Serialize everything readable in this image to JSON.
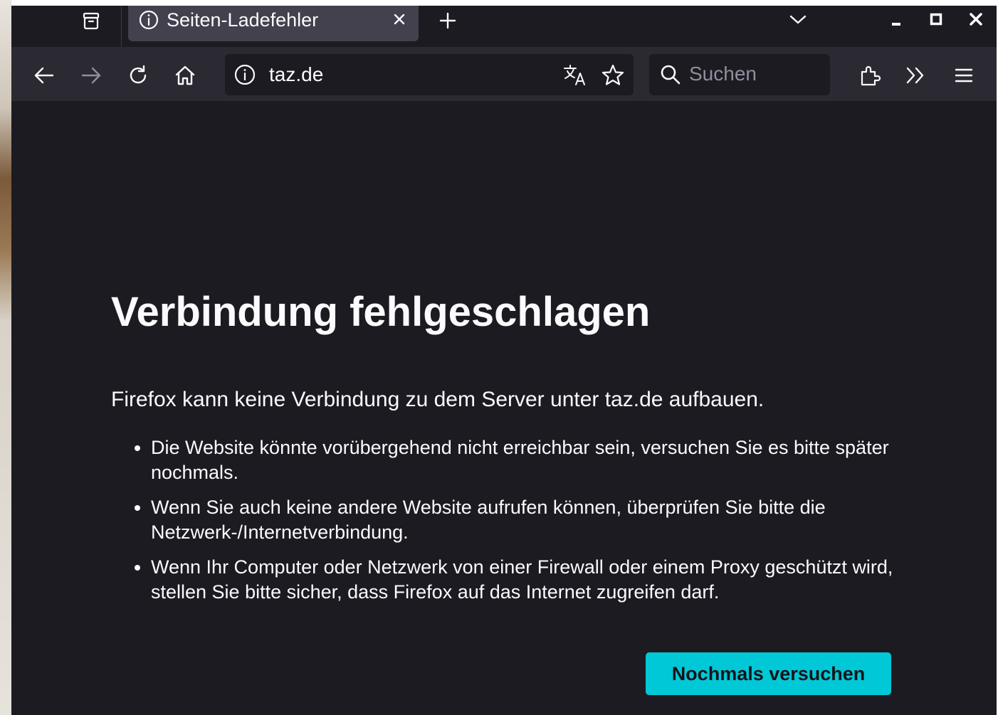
{
  "colors": {
    "window_bg": "#1c1b22",
    "toolbar_bg": "#2b2a33",
    "tab_active_bg": "#42414d",
    "text_primary": "#fbfbfe",
    "accent": "#00c8d7"
  },
  "tabbar": {
    "active_tab": {
      "title": "Seiten-Ladefehler",
      "icon": "info-icon",
      "close_icon": "close-icon"
    },
    "new_tab_icon": "plus-icon",
    "list_all_tabs_icon": "chevron-down-icon",
    "firefox_view_icon": "firefox-view-icon",
    "window_controls": [
      "minimize-icon",
      "maximize-icon",
      "close-icon"
    ]
  },
  "toolbar": {
    "back_icon": "arrow-left-icon",
    "forward_icon": "arrow-right-icon",
    "reload_icon": "reload-icon",
    "home_icon": "home-icon",
    "url": "taz.de",
    "site_info_icon": "info-icon",
    "translate_icon": "translate-icon",
    "bookmark_icon": "star-icon",
    "search": {
      "placeholder": "Suchen",
      "icon": "search-icon"
    },
    "extensions_icon": "puzzle-icon",
    "overflow_icon": "double-chevron-right-icon",
    "menu_icon": "hamburger-menu-icon"
  },
  "content": {
    "title": "Verbindung fehlgeschlagen",
    "description": "Firefox kann keine Verbindung zu dem Server unter taz.de aufbauen.",
    "bullets": [
      "Die Website könnte vorübergehend nicht erreichbar sein, versuchen Sie es bitte später nochmals.",
      "Wenn Sie auch keine andere Website aufrufen können, überprüfen Sie bitte die Netzwerk-/Internetverbindung.",
      "Wenn Ihr Computer oder Netzwerk von einer Firewall oder einem Proxy geschützt wird, stellen Sie bitte sicher, dass Firefox auf das Internet zugreifen darf."
    ],
    "retry_button": "Nochmals versuchen"
  }
}
